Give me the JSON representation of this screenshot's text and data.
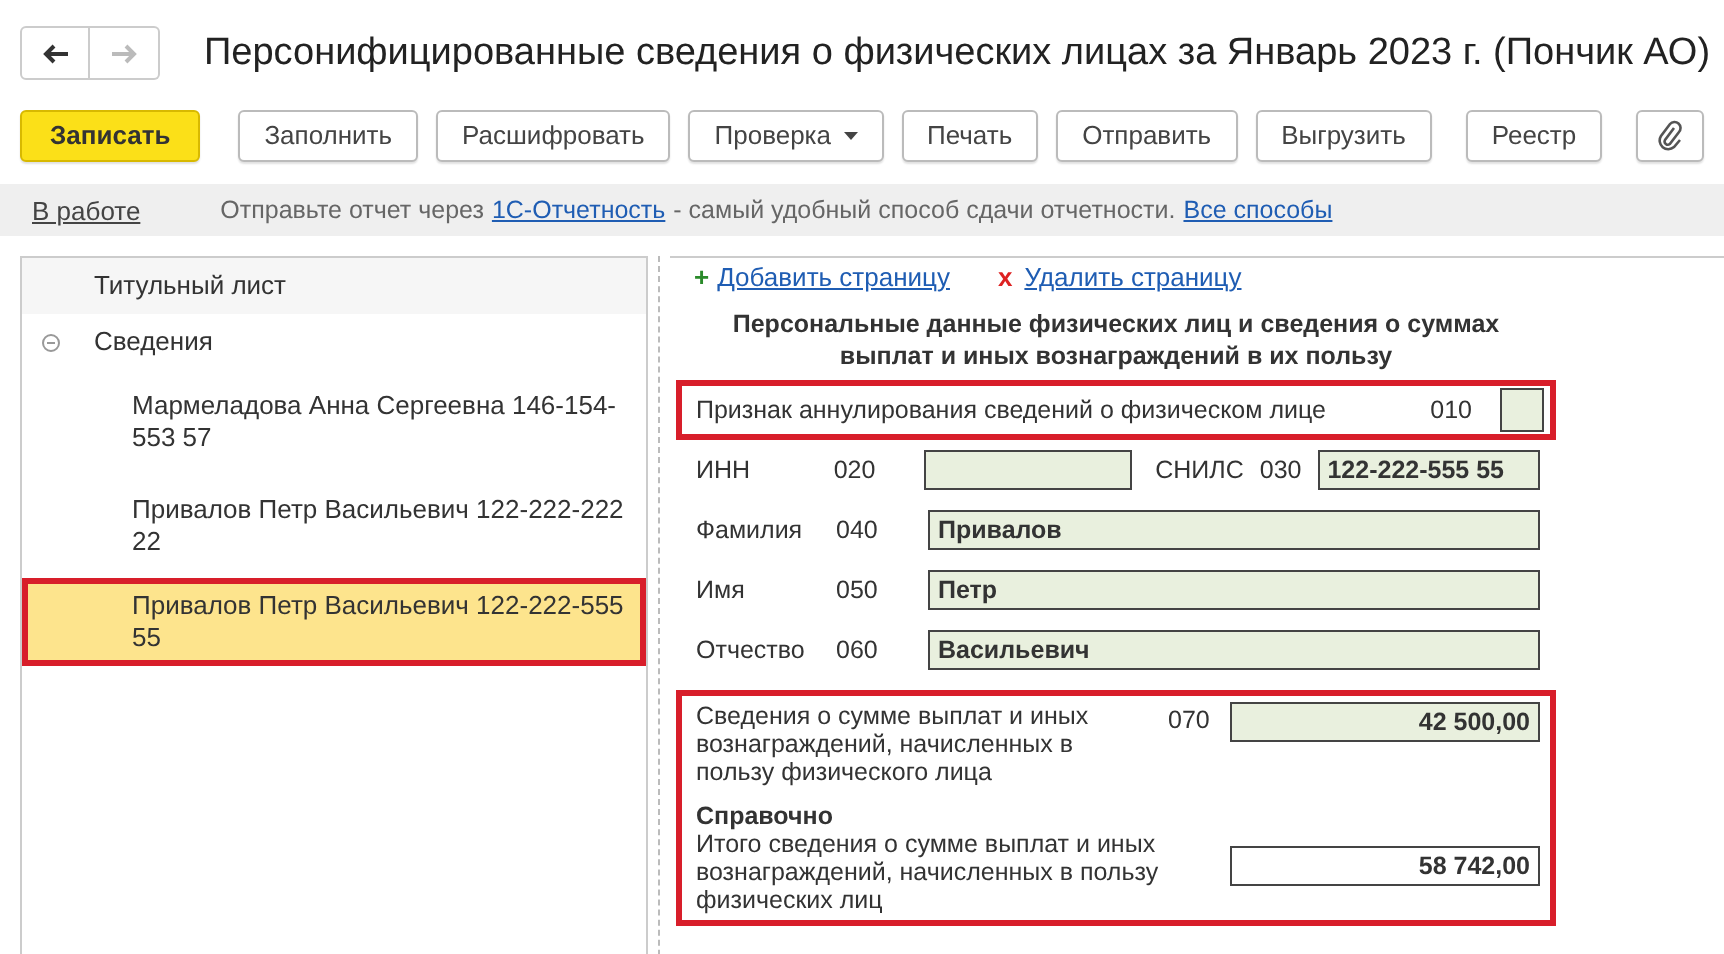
{
  "window": {
    "title": "Персонифицированные сведения о физических лицах за Январь 2023 г. (Пончик АО)"
  },
  "toolbar": [
    {
      "label": "Записать",
      "kind": "primary"
    },
    {
      "label": "Заполнить",
      "kind": "plain"
    },
    {
      "label": "Расшифровать",
      "kind": "plain"
    },
    {
      "label": "Проверка",
      "kind": "dropdown"
    },
    {
      "label": "Печать",
      "kind": "plain"
    },
    {
      "label": "Отправить",
      "kind": "plain"
    },
    {
      "label": "Выгрузить",
      "kind": "plain"
    },
    {
      "label": "Реестр",
      "kind": "plain"
    },
    {
      "kind": "attach"
    }
  ],
  "info_bar": {
    "status": "В работе",
    "text_before": "Отправьте отчет через",
    "link": "1С-Отчетность",
    "text_after": "- самый удобный способ сдачи отчетности.",
    "link2": "Все способы"
  },
  "tree": [
    {
      "label": "Титульный лист",
      "selected": false,
      "highlighted": false
    },
    {
      "label": "Сведения",
      "expanded": true,
      "selected": false,
      "highlighted": false,
      "children": [
        {
          "label": "Мармеладова Анна Сергеевна 146-154-553 57",
          "selected": false,
          "highlighted": false
        },
        {
          "label": "Привалов Петр Васильевич 122-222-222 22",
          "selected": false,
          "highlighted": false
        },
        {
          "label": "Привалов Петр Васильевич 122-222-555 55",
          "selected": true,
          "highlighted": true
        }
      ]
    }
  ],
  "form": {
    "add_icon": "+",
    "add_link": "Добавить страницу",
    "delete_icon": "x",
    "delete_link": "Удалить страницу",
    "title": "Персональные данные физических лиц и сведения о суммах выплат и иных вознаграждений в их пользу",
    "cancel_row": {
      "label": "Признак аннулирования сведений о физическом лице",
      "code": "010",
      "checked": false,
      "highlighted": true
    },
    "id_fields": [
      {
        "label": "ИНН",
        "code": "020"
      },
      {
        "label": "СНИЛС",
        "code": "030",
        "value": "122-222-555 55"
      }
    ],
    "name_fields": [
      {
        "label": "Фамилия",
        "code": "040",
        "value": "Привалов"
      },
      {
        "label": "Имя",
        "code": "050",
        "value": "Петр"
      },
      {
        "label": "Отчество",
        "code": "060",
        "value": "Васильевич"
      }
    ],
    "amounts": {
      "highlighted": true,
      "payments": {
        "label": "Сведения о сумме выплат и иных вознаграждений, начисленных в пользу физического лица",
        "code": "070",
        "value": "42 500,00"
      },
      "reference": {
        "heading": "Справочно",
        "label": "Итого сведения о сумме выплат и иных вознаграждений, начисленных в пользу физических лиц",
        "value": "58 742,00"
      }
    }
  }
}
